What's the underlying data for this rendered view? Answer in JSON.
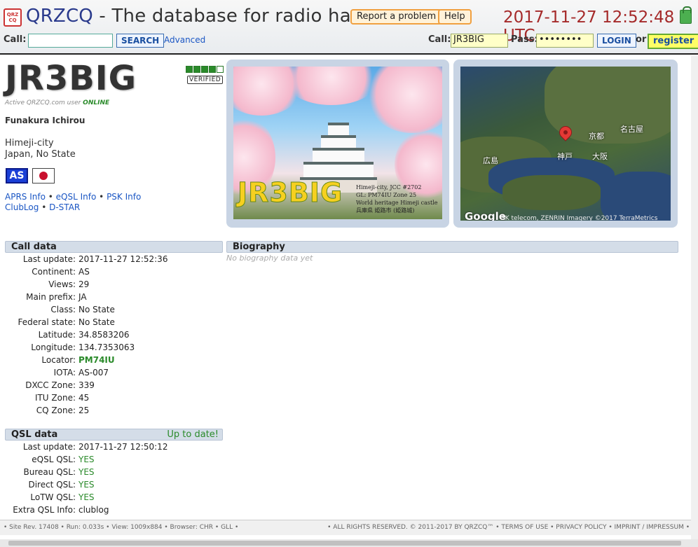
{
  "header": {
    "logo_text": "QRZ CQ",
    "brand": "QRZCQ",
    "tagline": " - The database for radio hams",
    "report_btn": "Report a problem",
    "help_btn": "Help",
    "datetime": "2017-11-27 12:52:48 UTC",
    "call_label": "Call:",
    "search_value": "",
    "search_btn": "SEARCH",
    "advanced_link": "Advanced",
    "login_call_label": "Call:",
    "login_call_value": "JR3BIG",
    "pass_label": "Pass:",
    "pass_value": "••••••••",
    "login_btn": "LOGIN",
    "or_text": "or",
    "register_btn": "register"
  },
  "profile": {
    "callsign": "JR3BIG",
    "verified_label": "VERIFIED",
    "verified_level": 4,
    "verified_max": 5,
    "active_prefix": "Active QRZCQ.com user ",
    "active_status": "ONLINE",
    "name": "Funakura Ichirou",
    "city": "Himeji-city",
    "country_state": "Japan, No State",
    "continent_badge": "AS",
    "links_line1": [
      "APRS Info",
      "eQSL Info",
      "PSK Info"
    ],
    "links_line2": [
      "ClubLog",
      "D-STAR"
    ]
  },
  "qsl_card": {
    "callsign": "JR3BIG",
    "line1": "Himeji-city, JCC #2702",
    "line2": "GL: PM74IU  Zone 25",
    "line3": "World heritage Himeji castle",
    "line4": "兵庫県 姫路市 (姫路城)"
  },
  "map": {
    "cities": [
      "広島",
      "神戸",
      "京都",
      "大阪",
      "名古屋"
    ],
    "google": "Google",
    "attribution": "Imagery ©2017 TerraMetrics",
    "attrib_extra": "SK telecom, ZENRIN"
  },
  "call_data": {
    "title": "Call data",
    "rows": [
      {
        "k": "Last update:",
        "v": "2017-11-27 12:52:36"
      },
      {
        "k": "Continent:",
        "v": "AS"
      },
      {
        "k": "Views:",
        "v": "29"
      },
      {
        "k": "Main prefix:",
        "v": "JA"
      },
      {
        "k": "Class:",
        "v": "No State"
      },
      {
        "k": "Federal state:",
        "v": "No State"
      },
      {
        "k": "Latitude:",
        "v": "34.8583206"
      },
      {
        "k": "Longitude:",
        "v": "134.7353063"
      },
      {
        "k": "Locator:",
        "v": "PM74IU"
      },
      {
        "k": "IOTA:",
        "v": "AS-007"
      },
      {
        "k": "DXCC Zone:",
        "v": "339"
      },
      {
        "k": "ITU Zone:",
        "v": "45"
      },
      {
        "k": "CQ Zone:",
        "v": "25"
      }
    ]
  },
  "biography": {
    "title": "Biography",
    "empty_text": "No biography data yet"
  },
  "qsl_data": {
    "title": "QSL data",
    "status": "Up to date!",
    "rows": [
      {
        "k": "Last update:",
        "v": "2017-11-27 12:50:12"
      },
      {
        "k": "eQSL QSL:",
        "v": "YES"
      },
      {
        "k": "Bureau QSL:",
        "v": "YES"
      },
      {
        "k": "Direct QSL:",
        "v": "YES"
      },
      {
        "k": "LoTW QSL:",
        "v": "YES"
      },
      {
        "k": "Extra QSL Info:",
        "v": "clublog"
      }
    ]
  },
  "footer": {
    "left": "• Site Rev. 17408 • Run: 0.033s • View: 1009x884 • Browser: CHR • GLL •",
    "right": "• ALL RIGHTS RESERVED. © 2011-2017 BY QRZCQ™ • TERMS OF USE • PRIVACY POLICY • IMPRINT / IMPRESSUM •"
  },
  "colors": {
    "accent": "#2a3a8c",
    "clock": "#a52a2a",
    "green": "#2a8a2a",
    "section": "#d4dde8"
  }
}
